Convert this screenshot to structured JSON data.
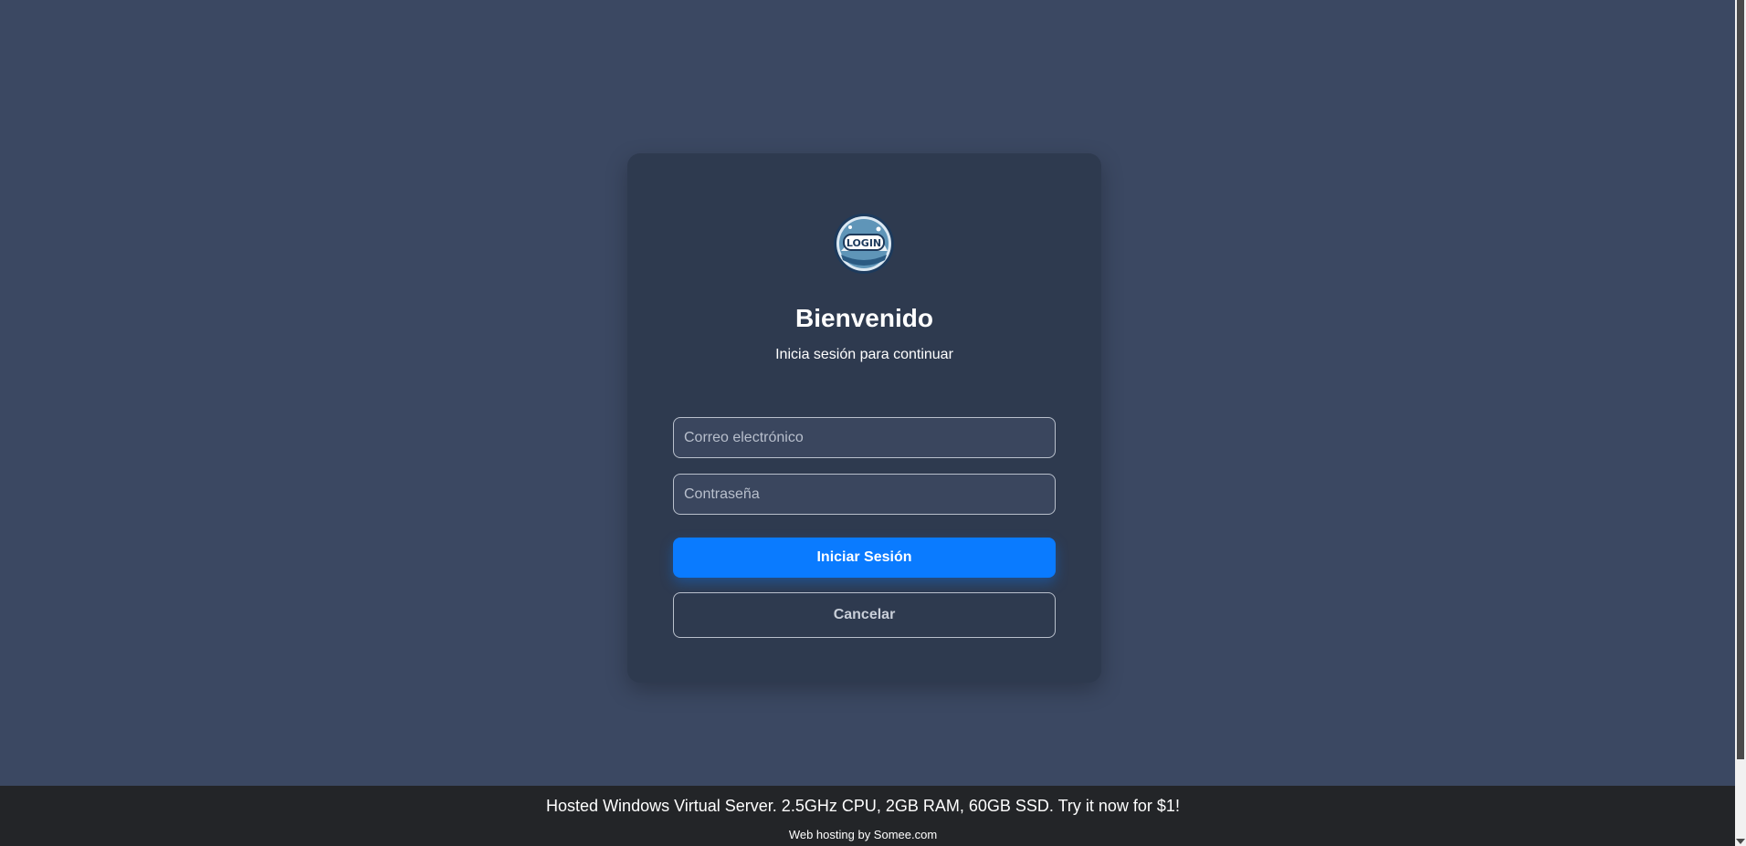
{
  "login": {
    "logo_text": "LOGIN",
    "title": "Bienvenido",
    "subtitle": "Inicia sesión para continuar",
    "email_placeholder": "Correo electrónico",
    "password_placeholder": "Contraseña",
    "submit_label": "Iniciar Sesión",
    "cancel_label": "Cancelar"
  },
  "footer": {
    "ad_text": "Hosted Windows Virtual Server. 2.5GHz CPU, 2GB RAM, 60GB SSD. Try it now for $1!",
    "hosting_text": "Web hosting by Somee.com"
  },
  "colors": {
    "page_background": "#3b4862",
    "card_background": "#2e3a4f",
    "primary": "#0a7bff",
    "footer_background": "#232528"
  },
  "icons": {
    "logo": "login-badge-icon",
    "scroll_down": "scroll-down-arrow-icon"
  }
}
